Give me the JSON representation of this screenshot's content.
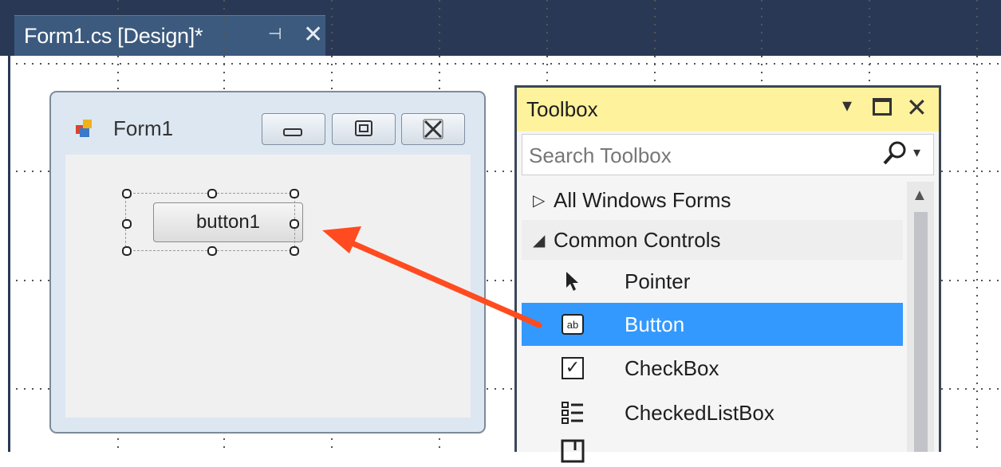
{
  "document_tab": {
    "title": "Form1.cs [Design]*",
    "pin_glyph": "⊣",
    "close_glyph": "✕"
  },
  "form": {
    "caption": "Form1",
    "icon": "form-app-icon",
    "button_label": "button1"
  },
  "toolbox": {
    "title": "Toolbox",
    "search_placeholder": "Search Toolbox",
    "groups": [
      {
        "label": "All Windows Forms",
        "expanded": false
      },
      {
        "label": "Common Controls",
        "expanded": true
      }
    ],
    "items": [
      {
        "label": "Pointer",
        "icon": "pointer-arrow-icon"
      },
      {
        "label": "Button",
        "icon": "button-control-icon",
        "selected": true
      },
      {
        "label": "CheckBox",
        "icon": "checkbox-icon"
      },
      {
        "label": "CheckedListBox",
        "icon": "checked-listbox-icon"
      }
    ]
  },
  "colors": {
    "title_bar": "#293955",
    "tab": "#3c5a7e",
    "toolbox_header": "#fff29d",
    "selection": "#3399ff",
    "arrow": "#ff4b1f"
  }
}
